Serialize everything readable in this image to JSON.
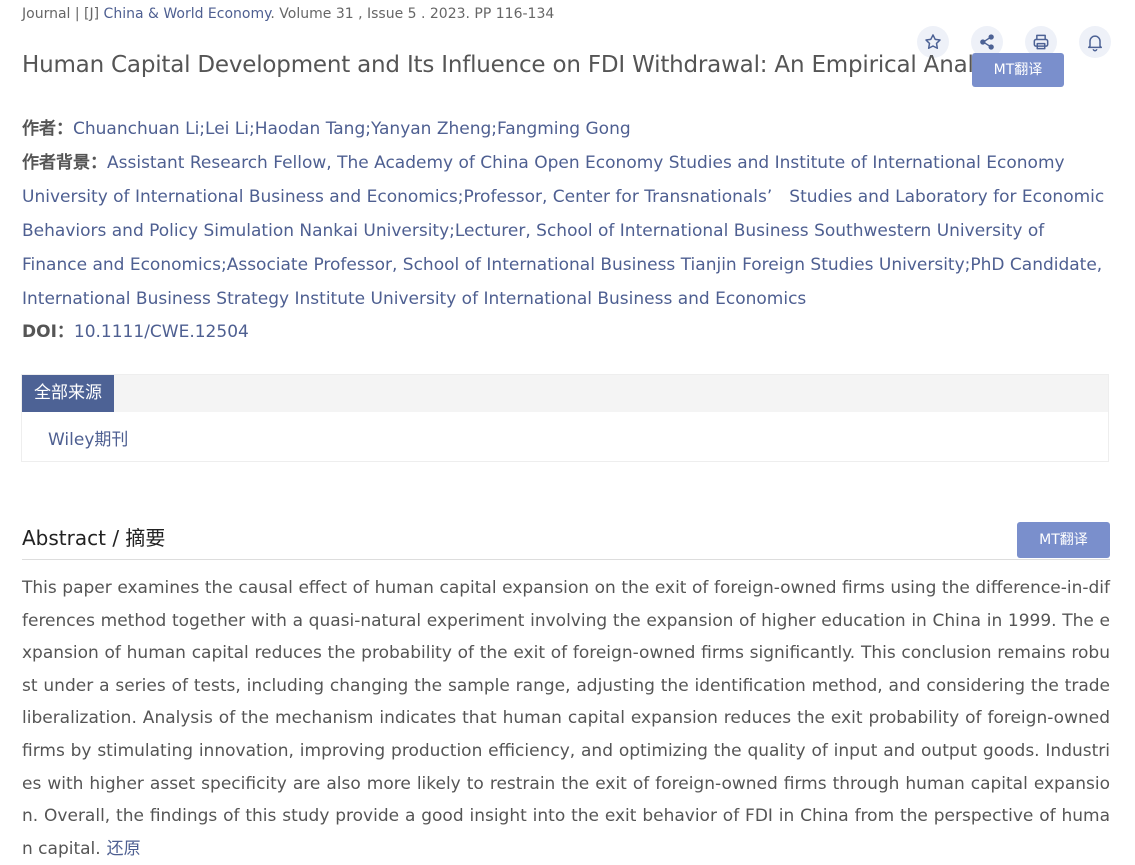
{
  "journal": {
    "prefix": "Journal | [J] ",
    "name": "China & World Economy",
    "suffix": ". Volume 31 , Issue 5 . 2023. PP 116-134"
  },
  "icons": [
    "star-icon",
    "share-icon",
    "print-icon",
    "bell-icon"
  ],
  "title": "Human Capital Development and Its Influence on FDI Withdrawal: An Empirical Analysis",
  "mt_label": "MT翻译",
  "authors": {
    "label": "作者：",
    "value": "Chuanchuan Li;Lei Li;Haodan Tang;Yanyan Zheng;Fangming Gong"
  },
  "background": {
    "label": "作者背景：",
    "value": "Assistant Research Fellow, The Academy of China Open Economy Studies and Institute of International Economy University of International Business and Economics;Professor, Center for Transnationals’　Studies and Laboratory for Economic Behaviors and Policy Simulation Nankai University;Lecturer, School of International Business Southwestern University of Finance and Economics;Associate Professor, School of International Business Tianjin Foreign Studies University;PhD Candidate, International Business Strategy Institute University of International Business and Economics"
  },
  "doi": {
    "label": "DOI：",
    "value": "10.1111/CWE.12504"
  },
  "sources": {
    "tab": "全部来源",
    "item": "Wiley期刊"
  },
  "abstract": {
    "heading": "Abstract / 摘要",
    "mt_label": "MT翻译",
    "text": "This paper examines the causal effect of human capital expansion on the exit of foreign-owned firms using the difference-in-differences method together with a quasi-natural experiment involving the expansion of higher education in China in 1999. The expansion of human capital reduces the probability of the exit of foreign-owned firms significantly. This conclusion remains robust under a series of tests, including changing the sample range, adjusting the identification method, and considering the trade liberalization. Analysis of the mechanism indicates that human capital expansion reduces the exit probability of foreign-owned firms by stimulating innovation, improving production efficiency, and optimizing the quality of input and output goods. Industries with higher asset specificity are also more likely to restrain the exit of foreign-owned firms through human capital expansion. Overall, the findings of this study provide a good insight into the exit behavior of FDI in China from the perspective of human capital.",
    "restore_label": "还原"
  },
  "colors": {
    "link": "#4e5f91",
    "mt_button": "#7a8fcc",
    "tab_active": "#4d6295",
    "icon_bg": "#eef1f8"
  }
}
